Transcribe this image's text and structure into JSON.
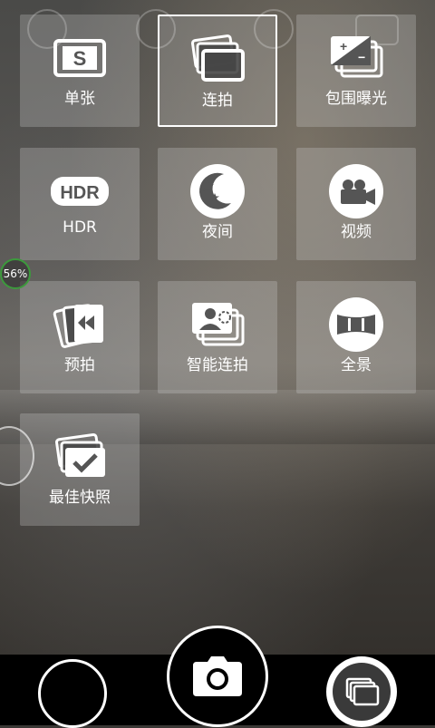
{
  "battery_percent_label": "56%",
  "modes": [
    {
      "label": "单张",
      "icon": "single-shot-icon",
      "selected": false
    },
    {
      "label": "连拍",
      "icon": "burst-icon",
      "selected": true
    },
    {
      "label": "包围曝光",
      "icon": "exposure-bracket-icon",
      "selected": false
    },
    {
      "label": "HDR",
      "icon": "hdr-icon",
      "icon_text": "HDR",
      "selected": false
    },
    {
      "label": "夜间",
      "icon": "night-moon-icon",
      "selected": false
    },
    {
      "label": "视频",
      "icon": "video-camera-icon",
      "selected": false
    },
    {
      "label": "预拍",
      "icon": "pre-shot-icon",
      "selected": false
    },
    {
      "label": "智能连拍",
      "icon": "smart-burst-icon",
      "selected": false
    },
    {
      "label": "全景",
      "icon": "panorama-icon",
      "selected": false
    },
    {
      "label": "最佳快照",
      "icon": "best-shot-icon",
      "selected": false
    }
  ],
  "icon_single_letter": "S",
  "colors": {
    "accent_ring": "#3c9a3c",
    "tile_bg": "rgba(210,210,210,0.28)",
    "bar": "#000000"
  }
}
